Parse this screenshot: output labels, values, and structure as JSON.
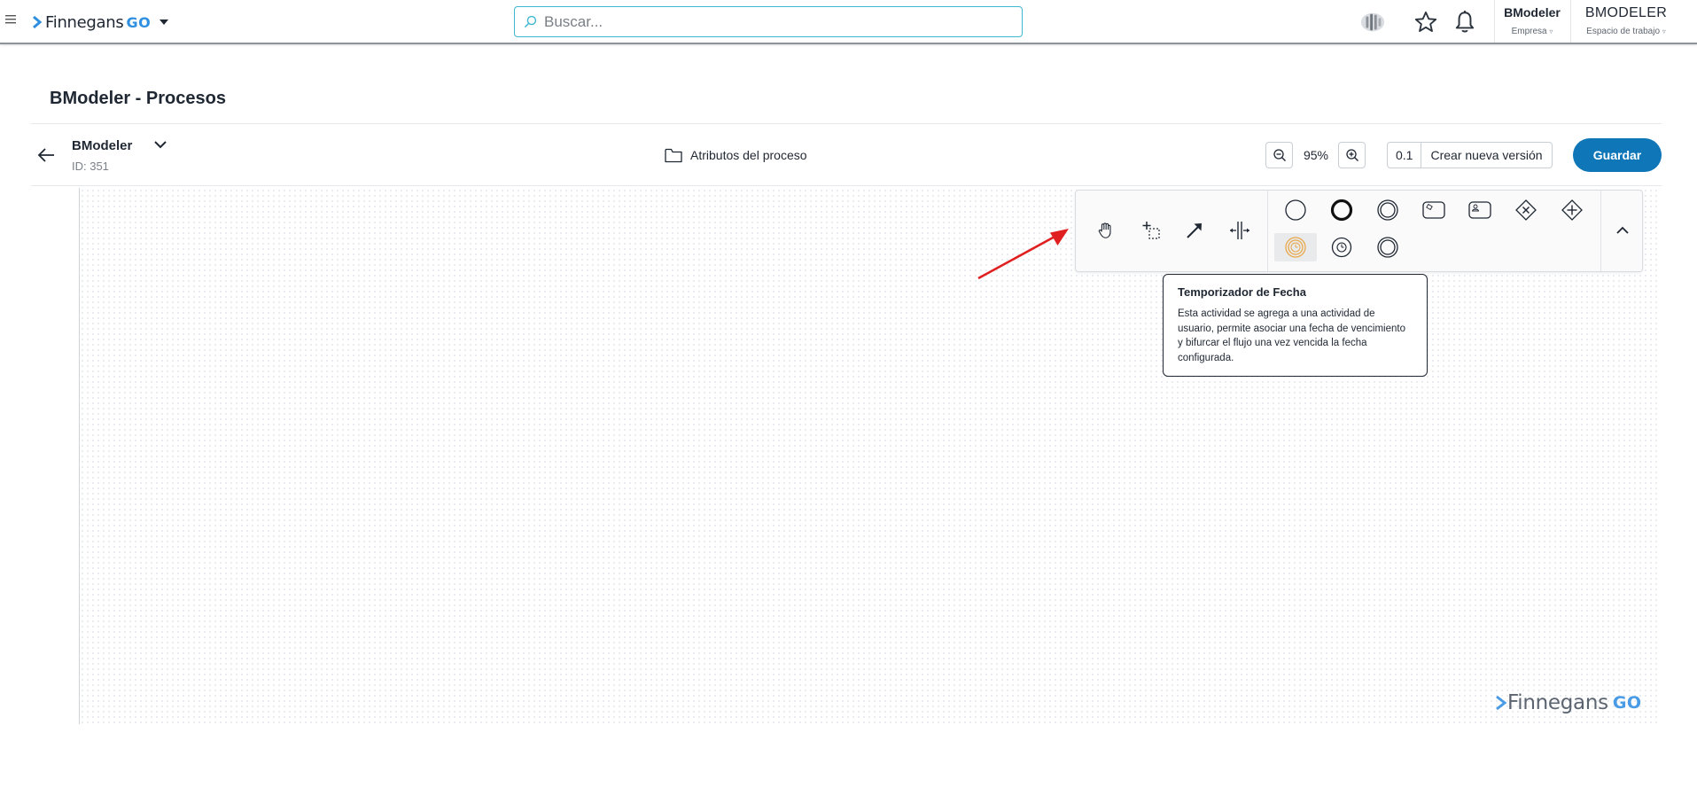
{
  "topbar": {
    "logo_word": "Finnegans",
    "logo_go": "GO",
    "search_placeholder": "Buscar...",
    "company_name": "BModeler",
    "company_label": "Empresa",
    "workspace_name": "BMODELER",
    "workspace_label": "Espacio de trabajo",
    "icons": [
      "menu-icon",
      "apps-icon",
      "star-icon",
      "bell-icon"
    ]
  },
  "page": {
    "title": "BModeler - Procesos",
    "process_name": "BModeler",
    "process_id": "ID: 351",
    "attributes_label": "Atributos del proceso",
    "zoom": "95%",
    "version": "0.1",
    "new_version_label": "Crear nueva versión",
    "save_label": "Guardar"
  },
  "palette": {
    "tools": [
      "hand-tool",
      "lasso-tool",
      "connect-tool",
      "space-tool"
    ],
    "shapes_row1": [
      "start-event",
      "end-event",
      "intermediate-event",
      "task",
      "user-task",
      "exclusive-gateway",
      "parallel-gateway"
    ],
    "shapes_row2": [
      "date-timer-event",
      "timer-event",
      "intermediate-event-2"
    ],
    "selected": "date-timer-event"
  },
  "tooltip": {
    "title": "Temporizador de Fecha",
    "body": "Esta actividad se agrega a una actividad de usuario, permite asociar una fecha de vencimiento y bifurcar el flujo una vez vencida la fecha configurada."
  },
  "watermark": {
    "word": "Finnegans",
    "go": "GO"
  },
  "colors": {
    "primary": "#0f77b8",
    "search_border": "#3fb7d1",
    "annotation_arrow": "#e02020",
    "timer_highlight": "#e8a84a"
  }
}
